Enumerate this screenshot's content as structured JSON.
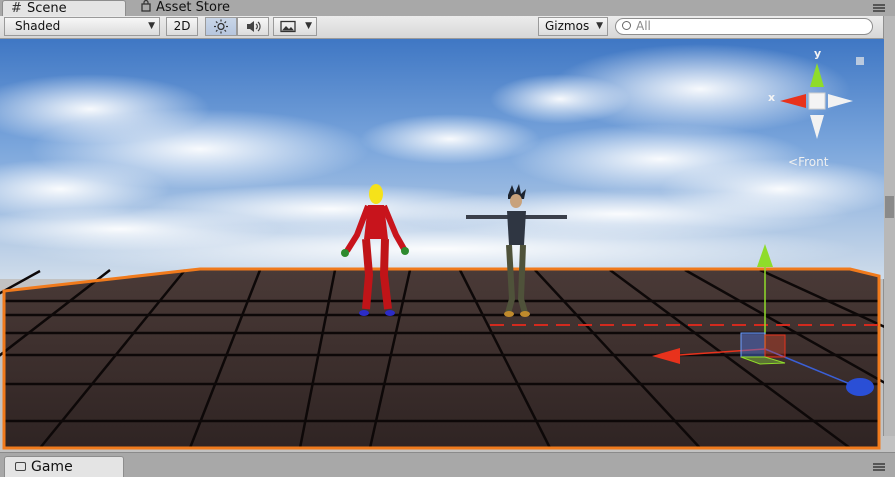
{
  "tabs": [
    {
      "label": "Scene",
      "icon": "grid-icon",
      "active": true
    },
    {
      "label": "Asset Store",
      "icon": "shopping-bag-icon",
      "active": false
    }
  ],
  "toolbar": {
    "shading_mode": "Shaded",
    "mode_2d": "2D",
    "lighting_icon": "sun-icon",
    "audio_icon": "speaker-icon",
    "effects_icon": "image-icon",
    "gizmos_label": "Gizmos",
    "search_placeholder": "All"
  },
  "orientation_gizmo": {
    "x_label": "x",
    "y_label": "y",
    "view_label": "Front",
    "colors": {
      "x": "#e8321c",
      "y": "#8fdc2a",
      "z": "#3a5fd6"
    }
  },
  "scene": {
    "sky_color": "#5b8fd2",
    "floor_color": "#3a2c2a",
    "selection_outline_color": "#f07a1c",
    "objects": [
      "red-humanoid",
      "spiky-hair-character",
      "move-tool-gizmo"
    ]
  },
  "bottom_tabs": [
    {
      "label": "Game",
      "icon": "game-controller-icon"
    }
  ]
}
